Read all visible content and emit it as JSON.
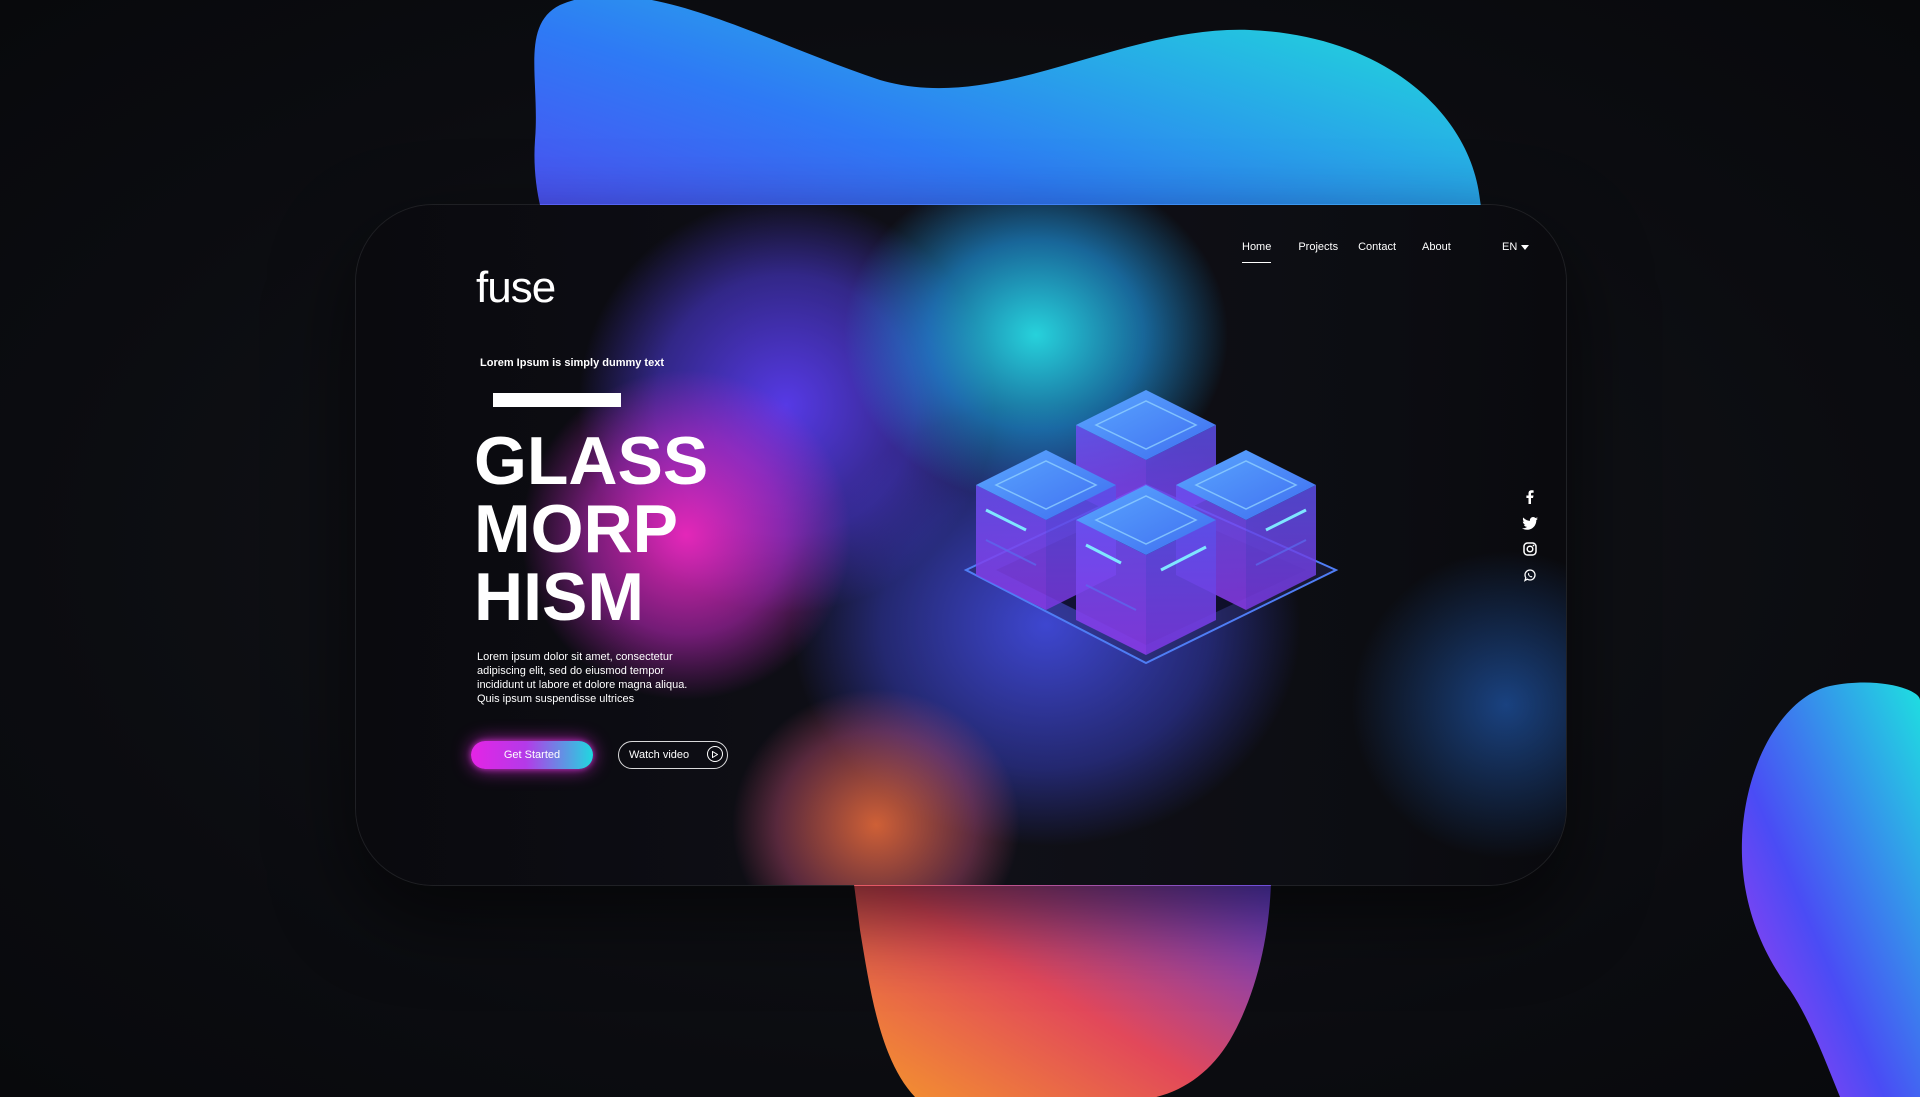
{
  "brand": {
    "logo_text": "fuse"
  },
  "nav": {
    "items": [
      {
        "label": "Home",
        "active": true
      },
      {
        "label": "Projects",
        "active": false
      },
      {
        "label": "Contact",
        "active": false
      },
      {
        "label": "About",
        "active": false
      }
    ],
    "language": "EN"
  },
  "hero": {
    "tagline": "Lorem Ipsum is simply dummy text",
    "headline": [
      "GLASS",
      "MORP",
      "HISM"
    ],
    "description": "Lorem ipsum dolor sit amet, consectetur adipiscing elit, sed do eiusmod tempor incididunt ut labore et dolore magna aliqua. Quis ipsum suspendisse ultrices",
    "primary_button": "Get Started",
    "secondary_button": "Watch video"
  },
  "social": [
    "facebook-icon",
    "twitter-icon",
    "instagram-icon",
    "whatsapp-icon"
  ],
  "colors": {
    "magenta": "#e424e6",
    "cyan": "#20d8e0",
    "blue": "#3a5cf0",
    "orange": "#f07a2a",
    "background": "#0d0e12"
  }
}
